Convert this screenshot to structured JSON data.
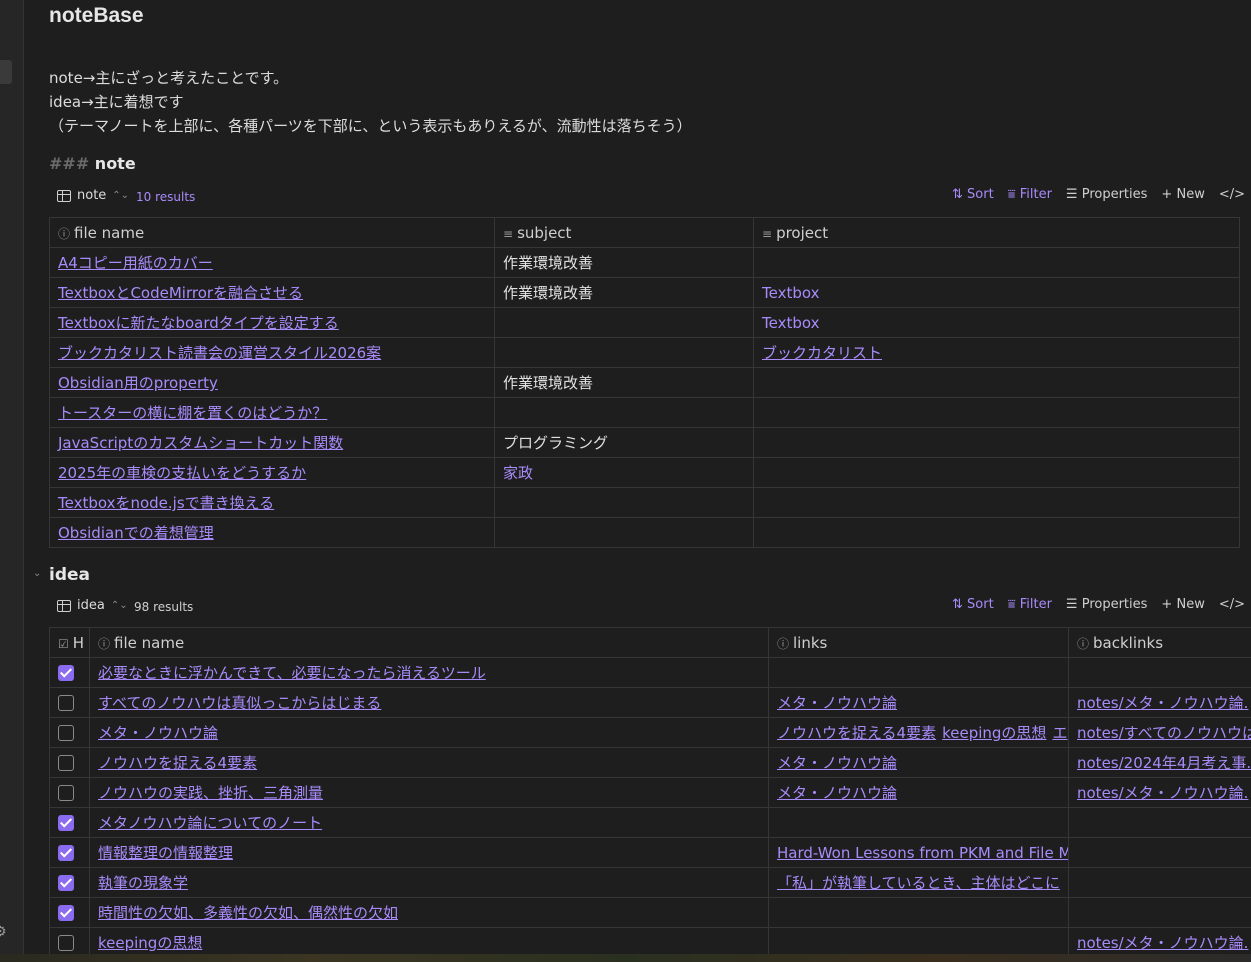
{
  "page": {
    "title": "noteBase",
    "paragraphs": [
      "note→主にざっと考えたことです。",
      "idea→主に着想です",
      "（テーマノートを上部に、各種パーツを下部に、という表示もありえるが、流動性は落ちそう）"
    ],
    "note_heading_hash": "###",
    "note_heading": "note",
    "idea_heading": "idea"
  },
  "toolbar": {
    "sort": "Sort",
    "filter": "Filter",
    "properties": "Properties",
    "new": "New",
    "code": "</>"
  },
  "note_view": {
    "name": "note",
    "count": "10 results",
    "headers": [
      "file name",
      "subject",
      "project"
    ],
    "rows": [
      {
        "file": "A4コピー用紙のカバー",
        "subject": "作業環境改善",
        "project": ""
      },
      {
        "file": "TextboxとCodeMirrorを融合させる",
        "subject": "作業環境改善",
        "project": "Textbox"
      },
      {
        "file": "Textboxに新たなboardタイプを設定する",
        "subject": "",
        "project": "Textbox"
      },
      {
        "file": "ブックカタリスト読書会の運営スタイル2026案",
        "subject": "",
        "project": "ブックカタリスト"
      },
      {
        "file": "Obsidian用のproperty",
        "subject": "作業環境改善",
        "project": ""
      },
      {
        "file": "トースターの横に棚を置くのはどうか？",
        "subject": "",
        "project": ""
      },
      {
        "file": "JavaScriptのカスタムショートカット関数",
        "subject": "プログラミング",
        "project": ""
      },
      {
        "file": "2025年の車検の支払いをどうするか",
        "subject": "家政",
        "project": ""
      },
      {
        "file": "Textboxをnode.jsで書き換える",
        "subject": "",
        "project": ""
      },
      {
        "file": "Obsidianでの着想管理",
        "subject": "",
        "project": ""
      }
    ]
  },
  "idea_view": {
    "name": "idea",
    "count": "98 results",
    "headers": [
      "H",
      "file name",
      "links",
      "backlinks"
    ],
    "rows": [
      {
        "checked": true,
        "file": "必要なときに浮かんできて、必要になったら消えるツール",
        "links": [],
        "backlinks": ""
      },
      {
        "checked": false,
        "file": "すべてのノウハウは真似っこからはじまる",
        "links": [
          "メタ・ノウハウ論"
        ],
        "backlinks": "notes/メタ・ノウハウ論."
      },
      {
        "checked": false,
        "file": "メタ・ノウハウ論",
        "links": [
          "ノウハウを捉える4要素",
          "keepingの思想",
          "エ"
        ],
        "backlinks": "notes/すべてのノウハウは"
      },
      {
        "checked": false,
        "file": "ノウハウを捉える4要素",
        "links": [
          "メタ・ノウハウ論"
        ],
        "backlinks": "notes/2024年4月考え事."
      },
      {
        "checked": false,
        "file": "ノウハウの実践、挫折、三角測量",
        "links": [
          "メタ・ノウハウ論"
        ],
        "backlinks": "notes/メタ・ノウハウ論."
      },
      {
        "checked": true,
        "file": "メタノウハウ論についてのノート",
        "links": [],
        "backlinks": ""
      },
      {
        "checked": true,
        "file": "情報整理の情報整理",
        "links": [
          "Hard-Won Lessons from PKM and File Ma"
        ],
        "backlinks": ""
      },
      {
        "checked": true,
        "file": "執筆の現象学",
        "links": [
          "「私」が執筆しているとき、主体はどこに"
        ],
        "backlinks": ""
      },
      {
        "checked": true,
        "file": "時間性の欠如、多義性の欠如、偶然性の欠如",
        "links": [],
        "backlinks": ""
      },
      {
        "checked": false,
        "file": "keepingの思想",
        "links": [],
        "backlinks": "notes/メタ・ノウハウ論."
      }
    ]
  },
  "colors": {
    "accent": "#a88bfa",
    "checkbox": "#8b6cf0",
    "background": "#1e1e1e"
  }
}
